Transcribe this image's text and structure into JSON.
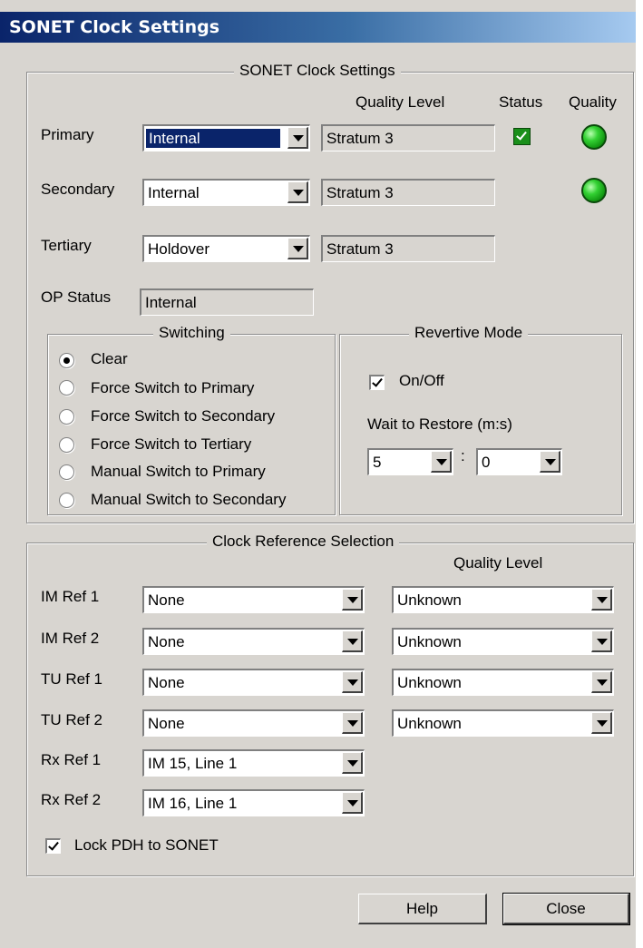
{
  "window": {
    "title": "SONET Clock Settings"
  },
  "clock_settings": {
    "group_title": "SONET Clock Settings",
    "col_quality_level": "Quality Level",
    "col_status": "Status",
    "col_quality": "Quality",
    "rows": [
      {
        "label": "Primary",
        "source": "Internal",
        "quality_level": "Stratum 3",
        "status_checked": true,
        "quality_led": "green"
      },
      {
        "label": "Secondary",
        "source": "Internal",
        "quality_level": "Stratum 3",
        "status_checked": false,
        "quality_led": "green"
      },
      {
        "label": "Tertiary",
        "source": "Holdover",
        "quality_level": "Stratum 3",
        "status_checked": false,
        "quality_led": "none"
      }
    ],
    "op_status_label": "OP Status",
    "op_status_value": "Internal"
  },
  "switching": {
    "title": "Switching",
    "options": [
      "Clear",
      "Force Switch to Primary",
      "Force Switch to Secondary",
      "Force Switch to Tertiary",
      "Manual Switch to Primary",
      "Manual Switch to Secondary"
    ],
    "selected_index": 0
  },
  "revertive": {
    "title": "Revertive Mode",
    "onoff_label": "On/Off",
    "onoff_checked": true,
    "wait_label": "Wait to Restore (m:s)",
    "minutes": "5",
    "separator": ":",
    "seconds": "0"
  },
  "clock_reference": {
    "title": "Clock Reference Selection",
    "quality_header": "Quality Level",
    "rows": [
      {
        "label": "IM Ref 1",
        "value": "None",
        "quality": "Unknown"
      },
      {
        "label": "IM Ref 2",
        "value": "None",
        "quality": "Unknown"
      },
      {
        "label": "TU Ref 1",
        "value": "None",
        "quality": "Unknown"
      },
      {
        "label": "TU Ref 2",
        "value": "None",
        "quality": "Unknown"
      },
      {
        "label": "Rx Ref 1",
        "value": "IM 15, Line 1"
      },
      {
        "label": "Rx Ref 2",
        "value": "IM 16, Line 1"
      }
    ],
    "lock_label": "Lock PDH to SONET",
    "lock_checked": true
  },
  "buttons": {
    "help": "Help",
    "close": "Close"
  },
  "colors": {
    "title_start": "#0a246a",
    "title_end": "#a6caf0",
    "dialog_bg": "#d8d5d0",
    "status_green": "#1a8f1a",
    "led_green": "#33d133"
  }
}
